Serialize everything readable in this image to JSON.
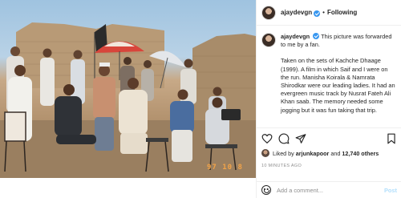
{
  "post": {
    "username": "ajaydevgn",
    "follow_separator": "•",
    "follow_label": "Following",
    "caption": {
      "username": "ajaydevgn",
      "line1": "This picture was forwarded to me by a fan.",
      "line2": "Taken on the sets of Kachche Dhaage (1999). A film in which Saif and I were on the run. Manisha Koirala & Namrata Shirodkar were our leading ladies. It had an evergreen music track by Nusrat Fateh Ali Khan saab. The memory needed some jogging but it was fun taking that trip."
    },
    "likes": {
      "prefix": "Liked by",
      "first_user": "arjunkapoor",
      "connector": "and",
      "others": "12,740 others"
    },
    "time_ago": "10 MINUTES AGO",
    "photo_date_stamp": "97 10 8"
  },
  "comment": {
    "placeholder": "Add a comment...",
    "post_label": "Post"
  },
  "icons": {
    "like": "heart-icon",
    "comment": "comment-bubble-icon",
    "share": "paper-plane-icon",
    "save": "bookmark-icon",
    "emoji": "emoji-icon",
    "verified": "verified-badge-icon"
  },
  "colors": {
    "verified": "#3897f0",
    "text": "#262626",
    "muted": "#8e8e8e",
    "post_disabled": "#b2dffc",
    "border": "#efefef"
  }
}
